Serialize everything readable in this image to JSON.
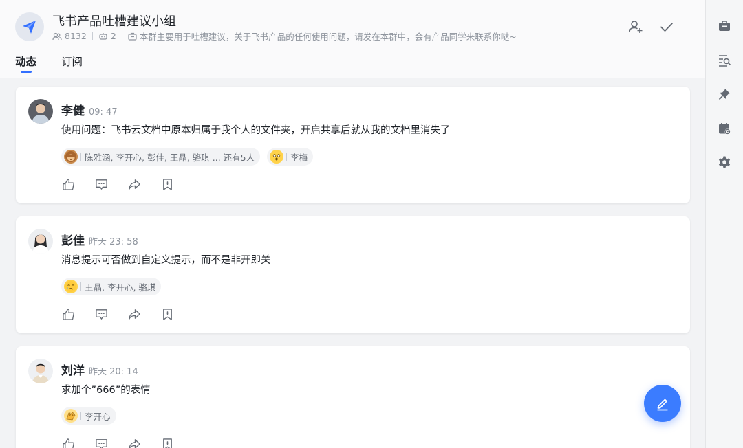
{
  "group": {
    "title": "飞书产品吐槽建议小组",
    "member_count": "8132",
    "bot_count": "2",
    "description": "本群主要用于吐槽建议，关于飞书产品的任何使用问题，请发在本群中，会有产品同学来联系你哒~"
  },
  "tabs": [
    {
      "label": "动态",
      "active": true
    },
    {
      "label": "订阅",
      "active": false
    }
  ],
  "posts": [
    {
      "author": "李健",
      "time": "09: 47",
      "content": "使用问题：飞书云文档中原本归属于我个人的文件夹，开启共享后就从我的文档里消失了",
      "reactions": [
        {
          "emoji": "monkey-emoji",
          "users": "陈雅涵, 李开心, 彭佳, 王晶, 骆琪 ... 还有5人"
        },
        {
          "emoji": "shocked-emoji",
          "users": "李梅"
        }
      ]
    },
    {
      "author": "彭佳",
      "time": "昨天 23: 58",
      "content": "消息提示可否做到自定义提示，而不是非开即关",
      "reactions": [
        {
          "emoji": "crying-emoji",
          "users": "王晶, 李开心, 骆琪"
        }
      ]
    },
    {
      "author": "刘洋",
      "time": "昨天 20: 14",
      "content": "求加个”666”的表情",
      "reactions": [
        {
          "emoji": "clap-emoji",
          "users": "李开心"
        }
      ]
    }
  ],
  "colors": {
    "accent": "#3370ff",
    "fab": "#3b7cff",
    "text_primary": "#1f2329",
    "text_secondary": "#8f959e"
  }
}
